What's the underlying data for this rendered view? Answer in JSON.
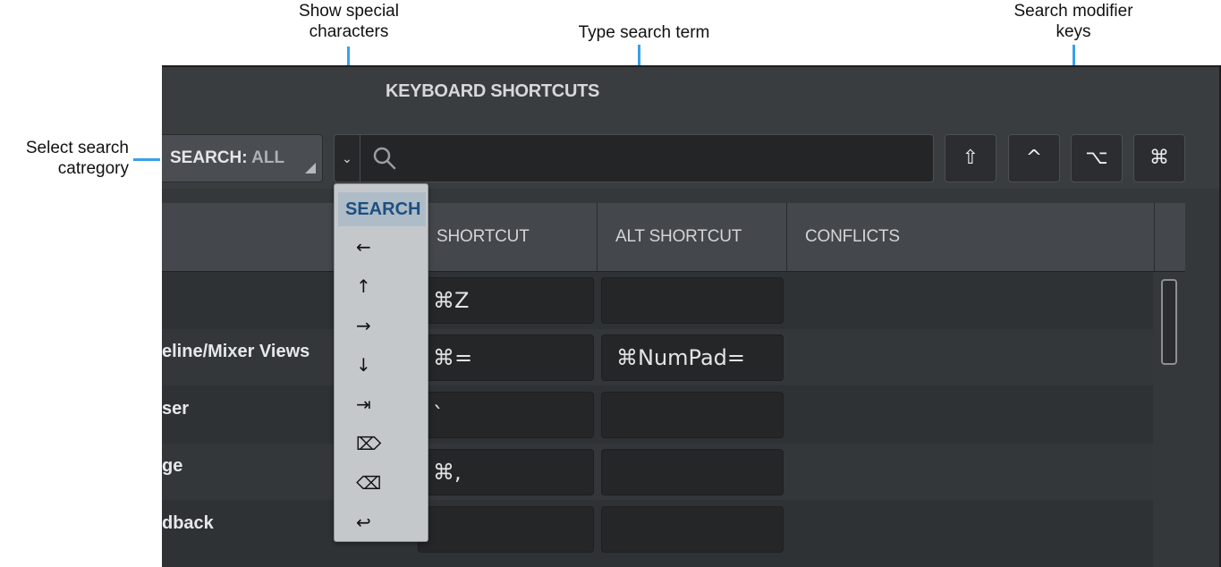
{
  "annotations": {
    "show_special": "Show special\ncharacters",
    "type_search": "Type search term",
    "modifier_keys": "Search modifier\nkeys",
    "select_category": "Select search\ncatregory"
  },
  "window": {
    "title": "KEYBOARD SHORTCUTS"
  },
  "search": {
    "category_label": "SEARCH:",
    "category_value": "ALL",
    "special_chars_glyph": "⌄",
    "term": "",
    "modifiers": [
      "⇧",
      "^",
      "⌥",
      "⌘"
    ]
  },
  "table": {
    "columns": [
      "SHORTCUT",
      "ALT SHORTCUT",
      "CONFLICTS"
    ],
    "rows": [
      {
        "command": "",
        "shortcut": "⌘Z",
        "alt": ""
      },
      {
        "command": "eline/Mixer Views",
        "shortcut": "⌘=",
        "alt": "⌘NumPad="
      },
      {
        "command": "ser",
        "shortcut": "`",
        "alt": ""
      },
      {
        "command": "ge",
        "shortcut": "⌘,",
        "alt": ""
      },
      {
        "command": "dback",
        "shortcut": "",
        "alt": ""
      }
    ]
  },
  "special_menu": {
    "header": "SEARCH",
    "items": [
      "←",
      "↑",
      "→",
      "↓",
      "⇥",
      "⌦",
      "⌫",
      "↩"
    ]
  },
  "colors": {
    "callout": "#3aa0e6",
    "popup_header": "#1d4f80"
  }
}
